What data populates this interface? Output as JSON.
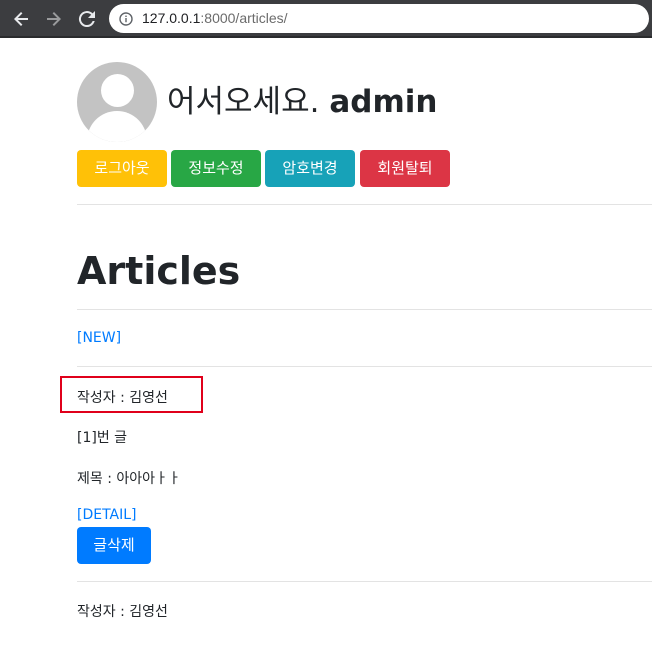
{
  "browser": {
    "url_host": "127.0.0.1",
    "url_rest": ":8000/articles/",
    "back_icon": "arrow-left-icon",
    "forward_icon": "arrow-right-icon",
    "reload_icon": "reload-icon",
    "info_icon": "info-icon"
  },
  "header": {
    "greeting": "어서오세요.",
    "username": "admin",
    "buttons": {
      "logout": "로그아웃",
      "edit_profile": "정보수정",
      "change_password": "암호변경",
      "delete_account": "회원탈퇴"
    },
    "colors": {
      "logout": "#ffc107",
      "edit_profile": "#28a745",
      "change_password": "#17a2b8",
      "delete_account": "#dc3545"
    }
  },
  "main": {
    "title": "Articles",
    "new_link": "[NEW]",
    "articles": [
      {
        "author_line": "작성자 : 김영선",
        "number_line": "[1]번 글",
        "subject_line": "제목 : 아아아ㅏㅏ",
        "detail_link": "[DETAIL]",
        "delete_button": "글삭제"
      },
      {
        "author_line": "작성자 : 김영선"
      }
    ]
  }
}
